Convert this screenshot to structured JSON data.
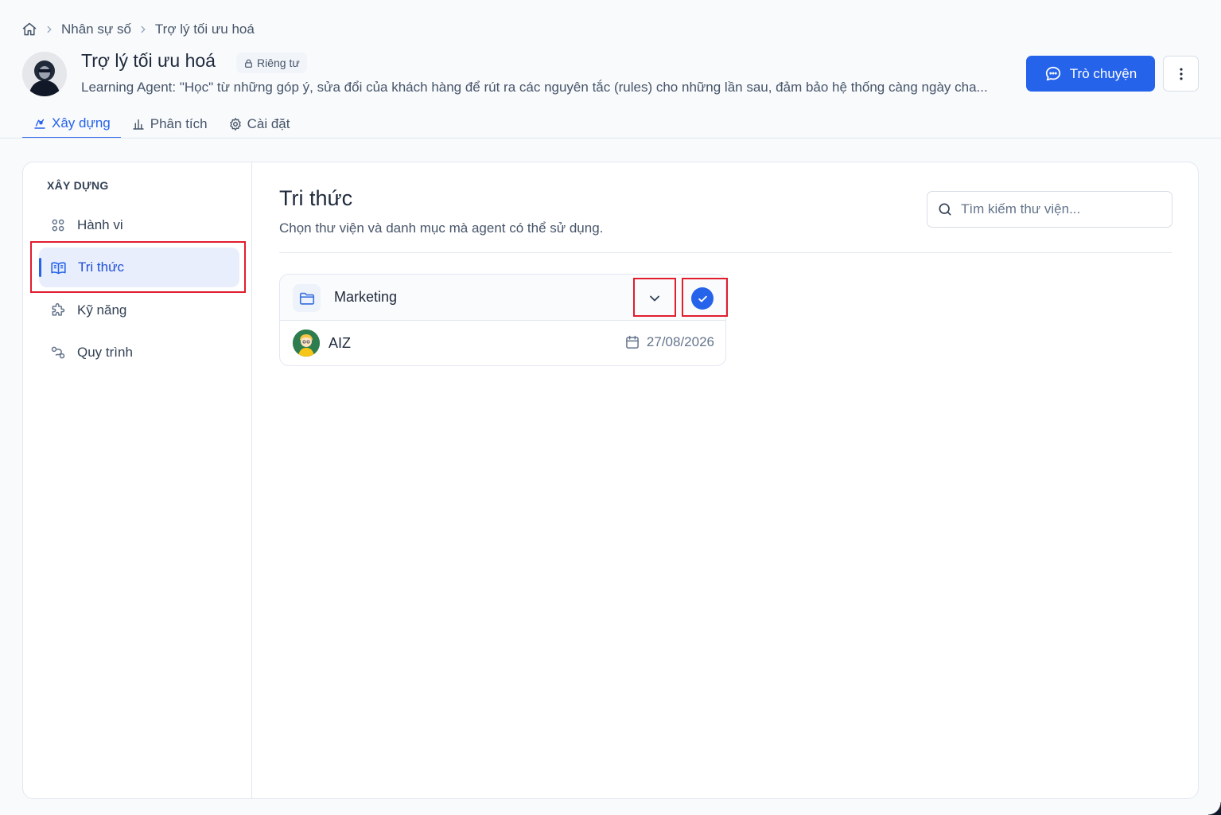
{
  "breadcrumb": {
    "items": [
      "Nhân sự số",
      "Trợ lý tối ưu hoá"
    ]
  },
  "header": {
    "title": "Trợ lý tối ưu hoá",
    "badge": "Riêng tư",
    "description": "Learning Agent: \"Học\" từ những góp ý, sửa đổi của khách hàng để rút ra các nguyên tắc (rules) cho những lần sau, đảm bảo hệ thống càng ngày cha...",
    "chat_button": "Trò chuyện"
  },
  "tabs": [
    {
      "label": "Xây dựng",
      "active": true
    },
    {
      "label": "Phân tích",
      "active": false
    },
    {
      "label": "Cài đặt",
      "active": false
    }
  ],
  "sidebar": {
    "heading": "XÂY DỰNG",
    "items": [
      {
        "label": "Hành vi",
        "icon": "behavior-icon",
        "active": false
      },
      {
        "label": "Tri thức",
        "icon": "book-icon",
        "active": true
      },
      {
        "label": "Kỹ năng",
        "icon": "puzzle-icon",
        "active": false
      },
      {
        "label": "Quy trình",
        "icon": "workflow-icon",
        "active": false
      }
    ]
  },
  "main": {
    "title": "Tri thức",
    "subtitle": "Chọn thư viện và danh mục mà agent có thể sử dụng.",
    "search_placeholder": "Tìm kiếm thư viện...",
    "library": {
      "name": "Marketing",
      "selected": true,
      "items": [
        {
          "name": "AIZ",
          "date": "27/08/2026"
        }
      ]
    }
  },
  "colors": {
    "accent": "#2563eb",
    "highlight": "#e11d2e",
    "active_bg": "#e8eefc"
  }
}
